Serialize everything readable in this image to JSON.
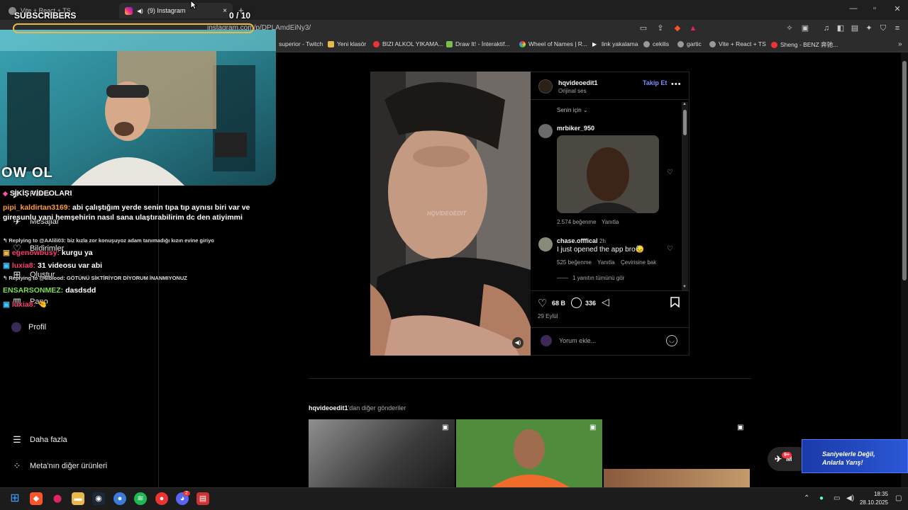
{
  "browser": {
    "tabs": [
      {
        "label": "Vite + React + TS"
      },
      {
        "label": "(9) Instagram"
      }
    ],
    "url": "instagram.com/p/DPLAmdEiNy3/",
    "bookmarks": [
      "superior - Twitch",
      "Yeni klasör",
      "BIZI ALKOL YIKAMA...",
      "Draw It! - İnteraktif...",
      "Wheel of Names | R...",
      "link yakalama",
      "cekilis",
      "gartic",
      "Vite + React + TS",
      "Sheng - BENZ 奔驰..."
    ],
    "colors": {
      "tabbar": "#1f1f1f",
      "toolbar": "#2c2c2c"
    }
  },
  "overlay": {
    "subscribers_label": "SUBSCRIBERS",
    "subscribers_count": "0",
    "subscribers_goal": "/ 10",
    "cam_logo": "OW OL",
    "chat": [
      {
        "user": "",
        "text": "SİKİŞ VİDEOLARI",
        "user_color": "#ff4fa3"
      },
      {
        "user": "pipi_kaldirtan3169:",
        "text": "abi çalıştığım yerde senin tıpa tıp aynısı biri var ve giresunlu yani hemşehirin nasıl sana ulaştırabilirim dc den atiyimmi",
        "user_color": "#ff9a3c"
      },
      {
        "reply": "Replying to @AAlili03: biz kızla zor konuşuyoz adam tanımadığı kızın evine giriyo"
      },
      {
        "user": "egenowbusy:",
        "text": "kurgu ya",
        "user_color": "#ff3d6e"
      },
      {
        "user": "luxia8:",
        "text": "31 videosu var abi",
        "user_color": "#ff3d6e"
      },
      {
        "reply": "Replying to @6lblood: GÖTÜNÜ SİKTİRİYOR DİYORUM İNANMIYONUZ"
      },
      {
        "user": "ENSARSONMEZ:",
        "text": "dasdsdd",
        "user_color": "#7ee04a"
      },
      {
        "user": "luxia8:",
        "text": "",
        "user_color": "#ff3d6e"
      }
    ]
  },
  "sidebar": {
    "items": [
      {
        "label": "Reels",
        "icon": "reels-icon"
      },
      {
        "label": "Mesajlar",
        "icon": "messages-icon"
      },
      {
        "label": "Bildirimler",
        "icon": "heart-icon"
      },
      {
        "label": "Oluştur",
        "icon": "plus-icon"
      },
      {
        "label": "Pano",
        "icon": "dashboard-icon"
      },
      {
        "label": "Profil",
        "icon": "avatar-icon"
      }
    ],
    "more_label": "Daha fazla",
    "meta_label": "Meta'nın diğer ürünleri"
  },
  "post": {
    "author": "hqvideoedit1",
    "follow_label": "Takip Et",
    "audio": "Orijinal ses",
    "watermark": "HQVIDEOEDIT",
    "sort_label": "Senin için",
    "comments": [
      {
        "user": "mrbiker_950",
        "likes": "2.574 beğenme",
        "reply": "Yanıtla"
      },
      {
        "user": "chase.offfical",
        "time": "2h",
        "text": "I just opened the app bro😓",
        "likes": "525 beğenme",
        "reply": "Yanıtla",
        "translate": "Çevirisine bak"
      }
    ],
    "view_replies": "1 yanıtın tümünü gör",
    "like_count": "68 B",
    "comment_count": "336",
    "date": "29 Eylül",
    "comment_placeholder": "Yorum ekle..."
  },
  "more_posts": {
    "heading_user": "hqvideoedit1",
    "heading_suffix": "'dan diğer gönderiler"
  },
  "messages_fab": {
    "badge": "9+",
    "label": "M"
  },
  "ad_overlay": {
    "line1": "Saniyelerle Değil,",
    "line2": "Anlarla Yarış!"
  },
  "taskbar": {
    "time": "18:35",
    "date": "28.10.2025",
    "discord_badge": "2"
  }
}
